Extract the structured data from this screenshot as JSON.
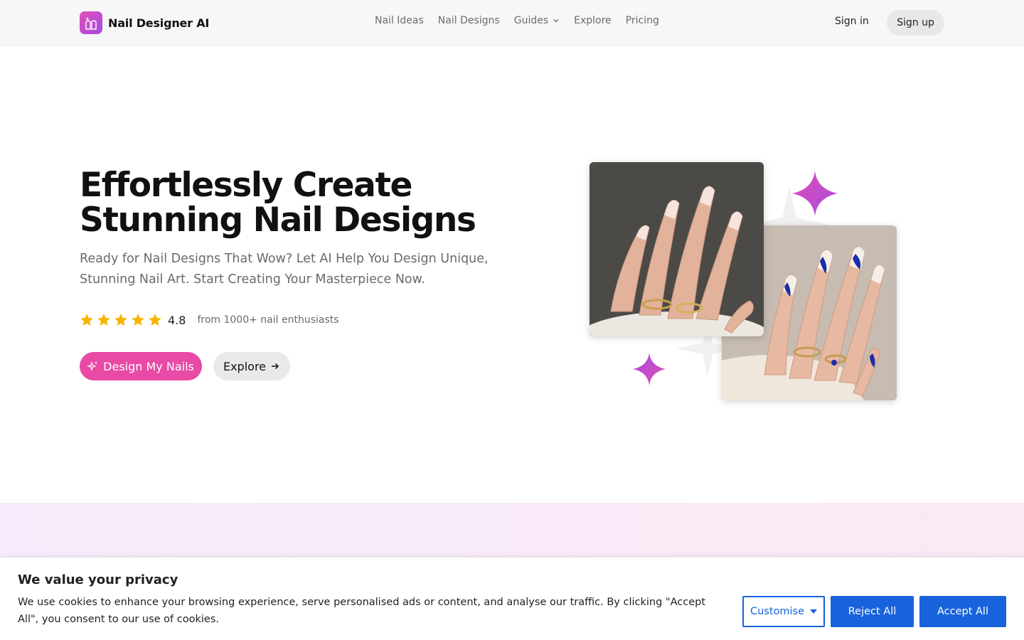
{
  "brand": {
    "name": "Nail Designer AI",
    "logo_icon": "nail-bottle-icon"
  },
  "nav": {
    "items": [
      {
        "label": "Nail Ideas"
      },
      {
        "label": "Nail Designs"
      },
      {
        "label": "Guides",
        "has_dropdown": true
      },
      {
        "label": "Explore"
      },
      {
        "label": "Pricing"
      }
    ],
    "sign_in": "Sign in",
    "sign_up": "Sign up"
  },
  "hero": {
    "title_line1": "Effortlessly Create",
    "title_line2": "Stunning Nail Designs",
    "subtitle": "Ready for Nail Designs That Wow? Let AI Help You Design Unique, Stunning Nail Art. Start Creating Your Masterpiece Now.",
    "rating": {
      "stars": 5,
      "value": "4.8",
      "text": "from 1000+ nail enthusiasts"
    },
    "primary_cta": "Design My Nails",
    "secondary_cta": "Explore"
  },
  "cookie": {
    "title": "We value your privacy",
    "text": "We use cookies to enhance your browsing experience, serve personalised ads or content, and analyse our traffic. By clicking \"Accept All\", you consent to our use of cookies.",
    "customise": "Customise",
    "reject": "Reject All",
    "accept": "Accept All"
  },
  "colors": {
    "accent_pink": "#e84aa6",
    "star_yellow": "#f7b500",
    "cookie_blue": "#1863dc"
  }
}
